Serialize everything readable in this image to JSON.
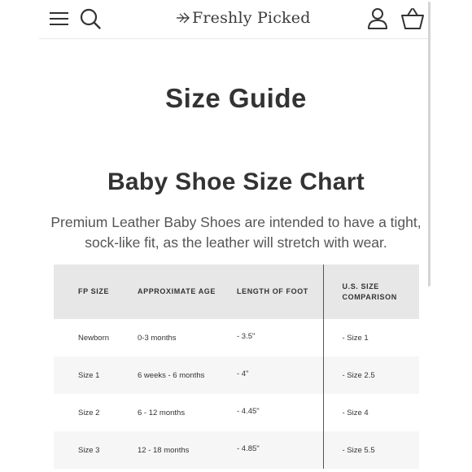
{
  "header": {
    "logo_text": "Freshly Picked",
    "icons": [
      "menu-icon",
      "search-icon",
      "account-icon",
      "cart-icon"
    ]
  },
  "page_title": "Size Guide",
  "section_title": "Baby Shoe Size Chart",
  "intro": "Premium Leather Baby Shoes are intended to have a tight, sock-like fit, as the leather will stretch with wear.",
  "table": {
    "headers": [
      "FP SIZE",
      "APPROXIMATE AGE",
      "LENGTH OF FOOT",
      "U.S. SIZE COMPARISON"
    ],
    "rows": [
      [
        "Newborn",
        "0-3 months",
        "- 3.5\"",
        "- Size 1"
      ],
      [
        "Size 1",
        "6 weeks - 6 months",
        "- 4\"",
        "- Size 2.5"
      ],
      [
        "Size 2",
        "6 - 12 months",
        "- 4.45\"",
        "- Size 4"
      ],
      [
        "Size 3",
        "12 - 18 months",
        "- 4.85\"",
        "- Size 5.5"
      ]
    ]
  },
  "colors": {
    "text": "#333333",
    "header_bg": "#e7e7e7",
    "row_alt_bg": "#f6f6f6",
    "divider": "#555555"
  }
}
